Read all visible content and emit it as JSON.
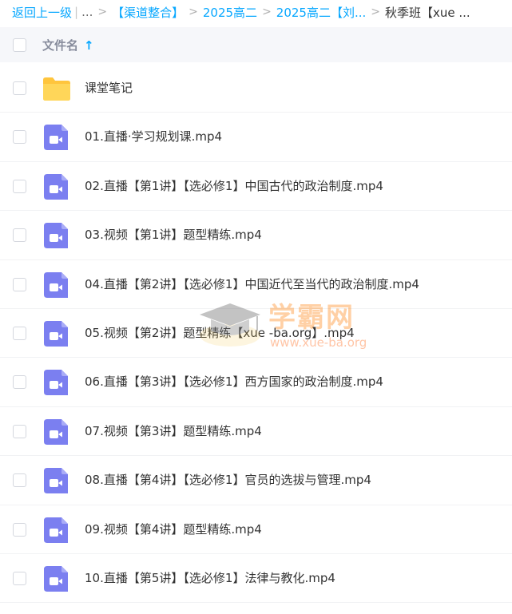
{
  "breadcrumb": {
    "back": "返回上一级",
    "ellipsis": "...",
    "crumbs": [
      "【渠道整合】",
      "2025高二",
      "2025高二【刘..."
    ],
    "current": "秋季班【xue ..."
  },
  "header": {
    "column_name": "文件名",
    "sort_icon": "arrow-up-icon"
  },
  "files": [
    {
      "name": "课堂笔记",
      "type": "folder"
    },
    {
      "name": "01.直播·学习规划课.mp4",
      "type": "video"
    },
    {
      "name": "02.直播【第1讲】【选必修1】中国古代的政治制度.mp4",
      "type": "video"
    },
    {
      "name": "03.视频【第1讲】题型精练.mp4",
      "type": "video"
    },
    {
      "name": "04.直播【第2讲】【选必修1】中国近代至当代的政治制度.mp4",
      "type": "video"
    },
    {
      "name": "05.视频【第2讲】题型精练【xue -ba.org】.mp4",
      "type": "video"
    },
    {
      "name": "06.直播【第3讲】【选必修1】西方国家的政治制度.mp4",
      "type": "video"
    },
    {
      "name": "07.视频【第3讲】题型精练.mp4",
      "type": "video"
    },
    {
      "name": "08.直播【第4讲】【选必修1】官员的选拔与管理.mp4",
      "type": "video"
    },
    {
      "name": "09.视频【第4讲】题型精练.mp4",
      "type": "video"
    },
    {
      "name": "10.直播【第5讲】【选必修1】法律与教化.mp4",
      "type": "video"
    }
  ],
  "watermark": {
    "title": "学霸网",
    "url": "www.xue-ba.org"
  },
  "colors": {
    "accent": "#06a7ff",
    "folder": "#ffd659",
    "video": "#7b7ff0",
    "watermark": "#ff7c00"
  }
}
